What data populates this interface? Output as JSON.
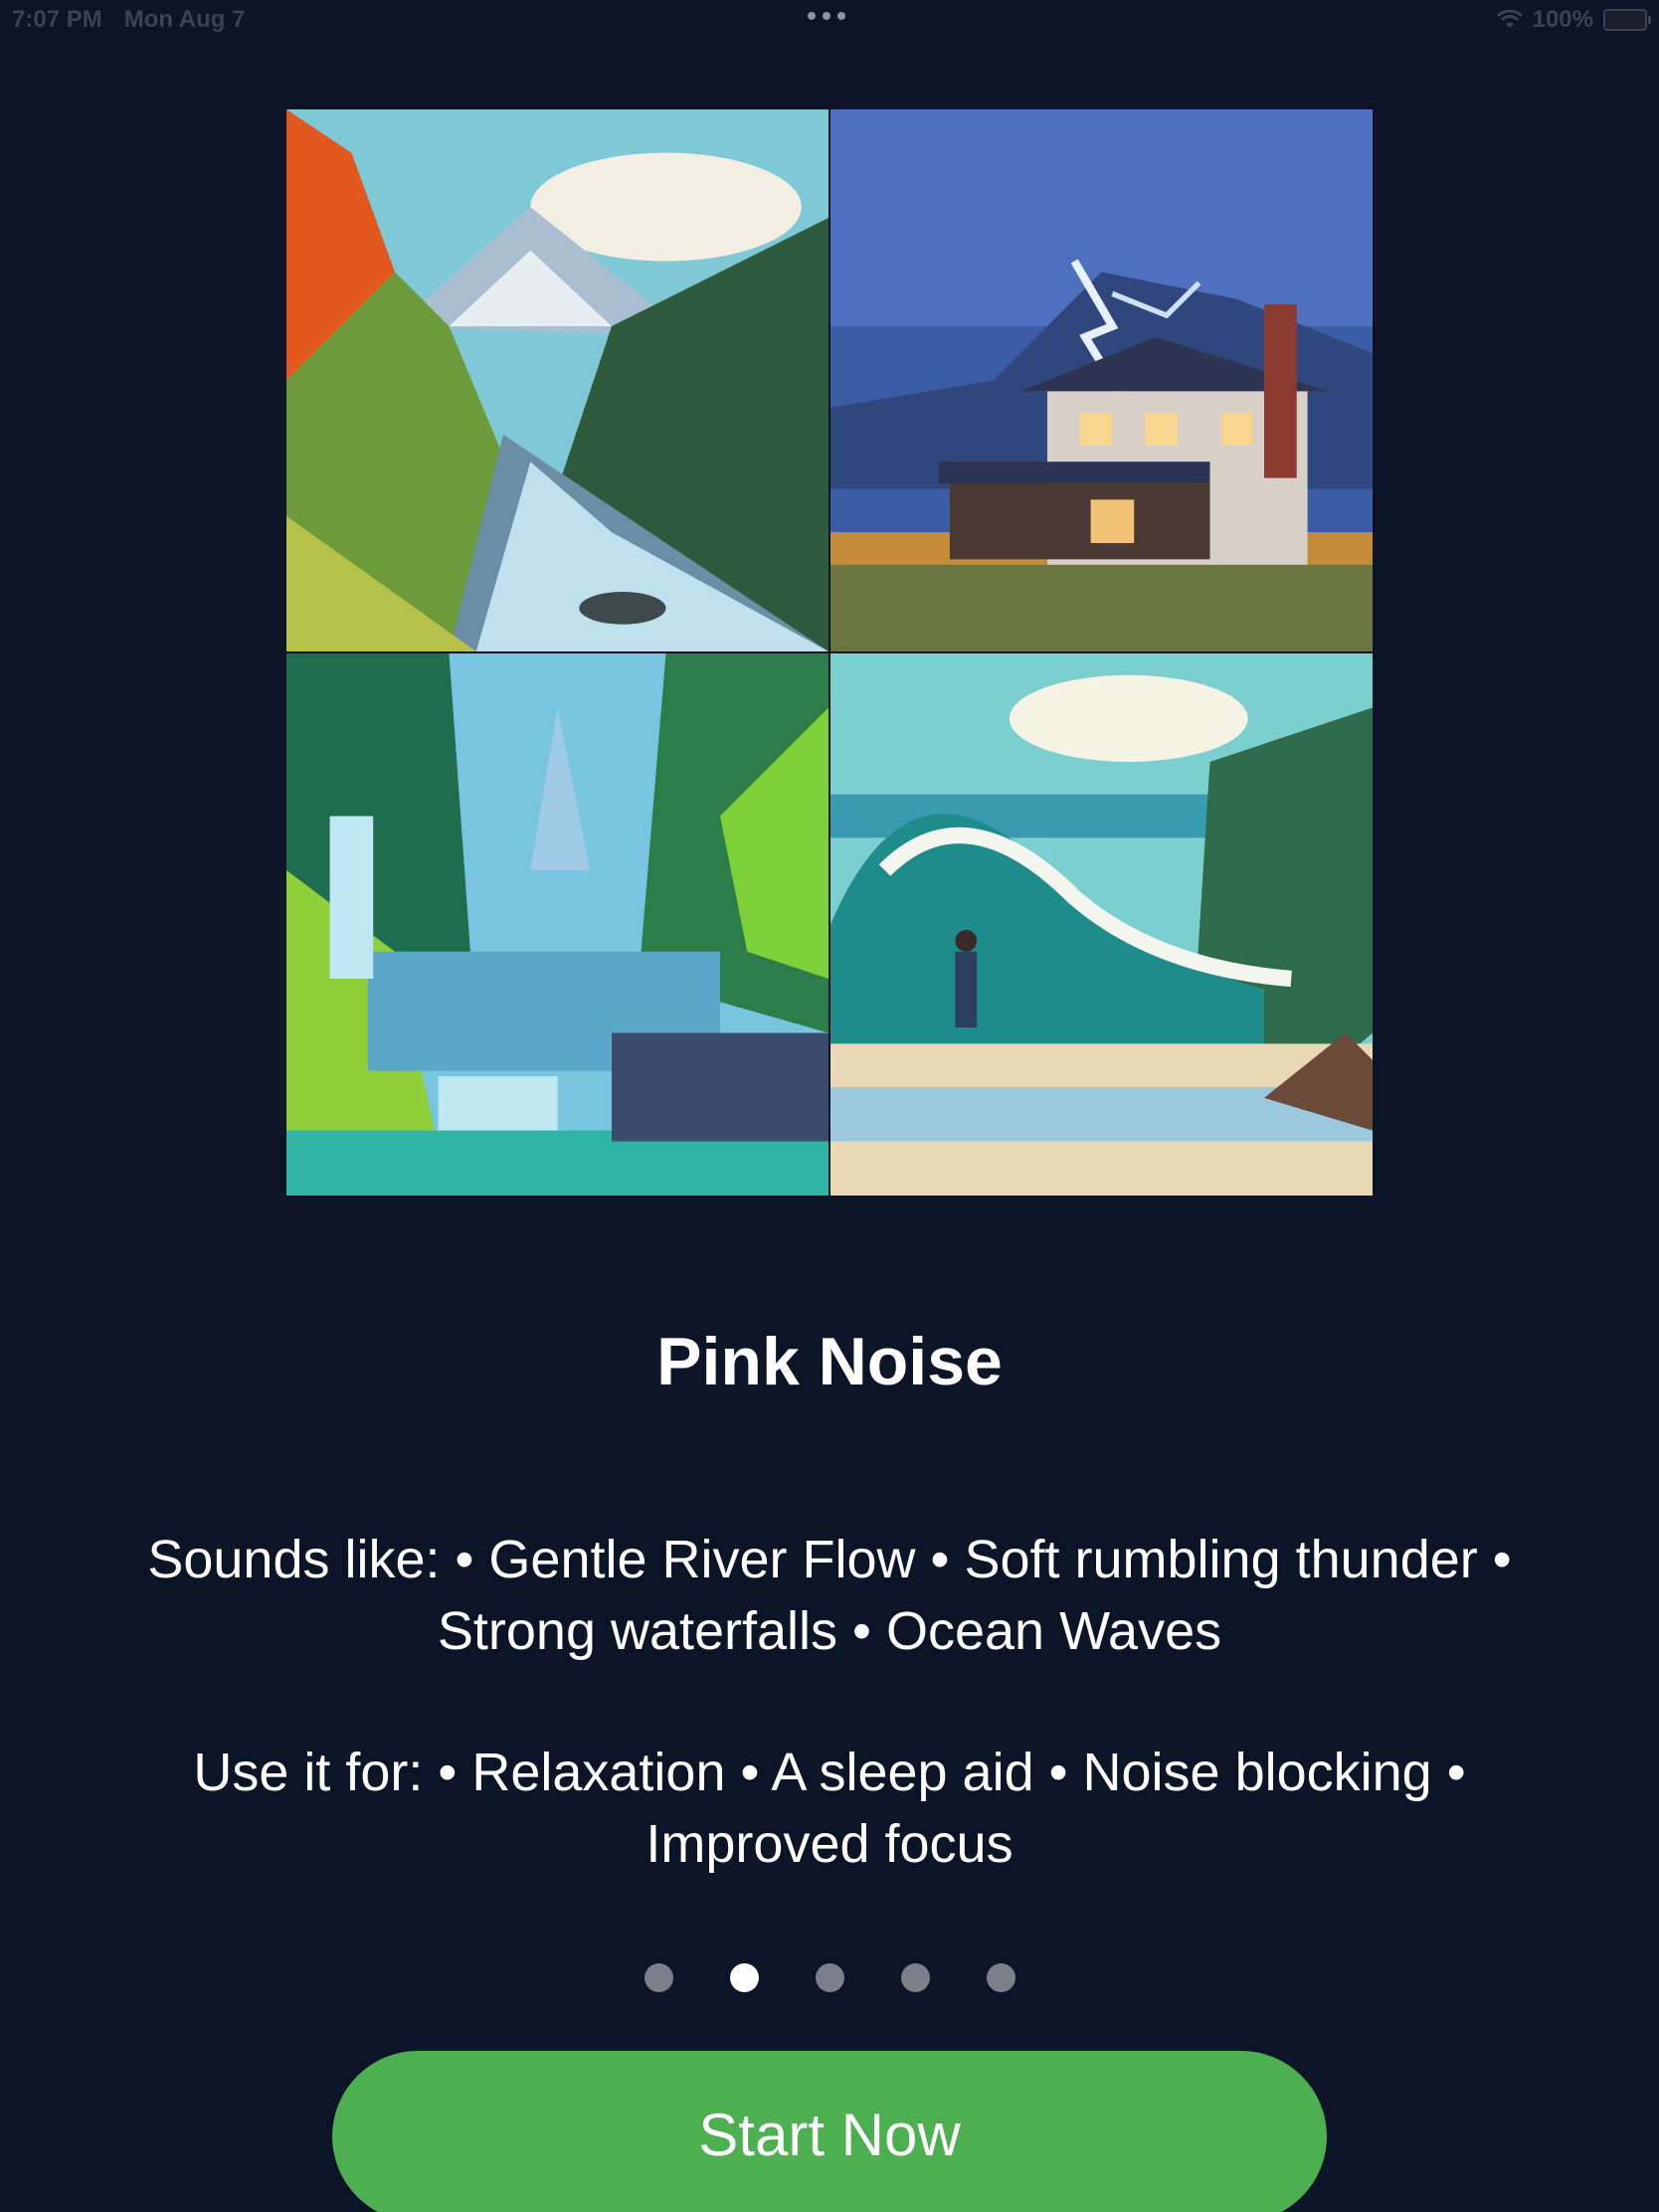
{
  "status_bar": {
    "time": "7:07 PM",
    "date": "Mon Aug 7",
    "battery": "100%",
    "icons": [
      "wifi-icon",
      "battery-icon",
      "multitasking-dots-icon"
    ]
  },
  "artwork": {
    "tiles": [
      {
        "name": "river-scene"
      },
      {
        "name": "thunderstorm-house-scene"
      },
      {
        "name": "waterfall-scene"
      },
      {
        "name": "ocean-waves-scene"
      }
    ]
  },
  "content": {
    "title": "Pink Noise",
    "sounds_like": "Sounds like: • Gentle River Flow • Soft rumbling thunder • Strong waterfalls • Ocean Waves",
    "use_it_for": "Use it for: • Relaxation • A sleep aid • Noise blocking • Improved focus"
  },
  "pager": {
    "count": 5,
    "active_index": 1
  },
  "cta": {
    "label": "Start Now",
    "color": "#4caf50"
  },
  "colors": {
    "background": "#0b1527",
    "text": "#ffffff"
  }
}
